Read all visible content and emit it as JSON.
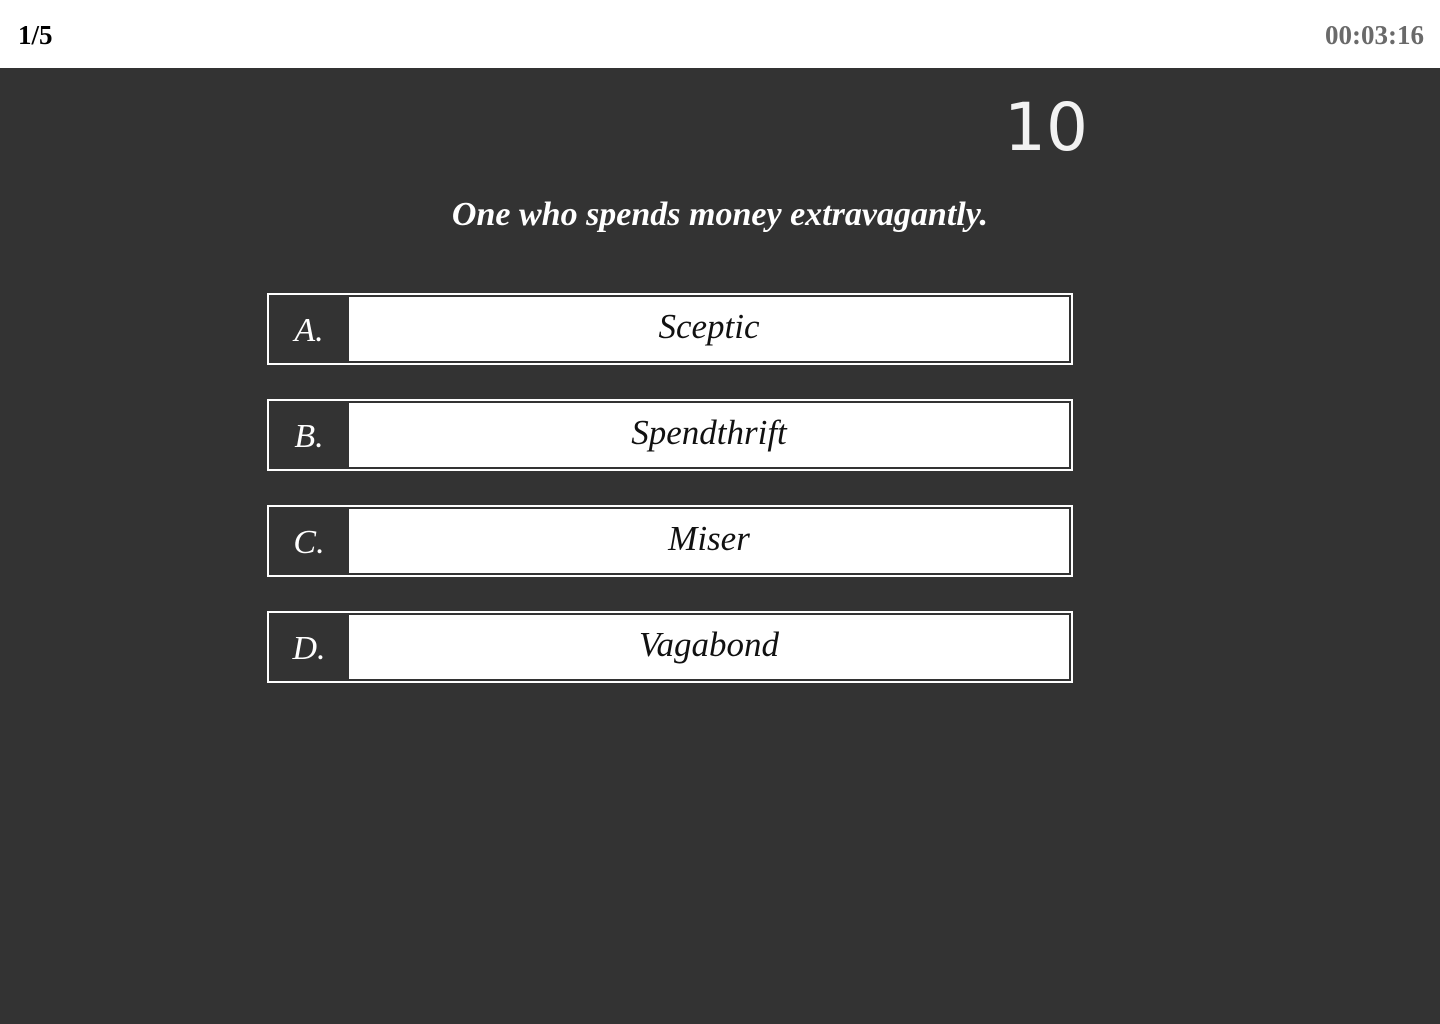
{
  "header": {
    "progress": "1/5",
    "elapsed_time": "00:03:16"
  },
  "countdown": "10",
  "question": "One who spends money extravagantly.",
  "options": [
    {
      "letter": "A.",
      "text": "Sceptic"
    },
    {
      "letter": "B.",
      "text": "Spendthrift"
    },
    {
      "letter": "C.",
      "text": "Miser"
    },
    {
      "letter": "D.",
      "text": "Vagabond"
    }
  ],
  "colors": {
    "background": "#333333",
    "header_background": "#ffffff",
    "timer_text": "#6a6a6a",
    "option_fill": "#ffffff"
  }
}
